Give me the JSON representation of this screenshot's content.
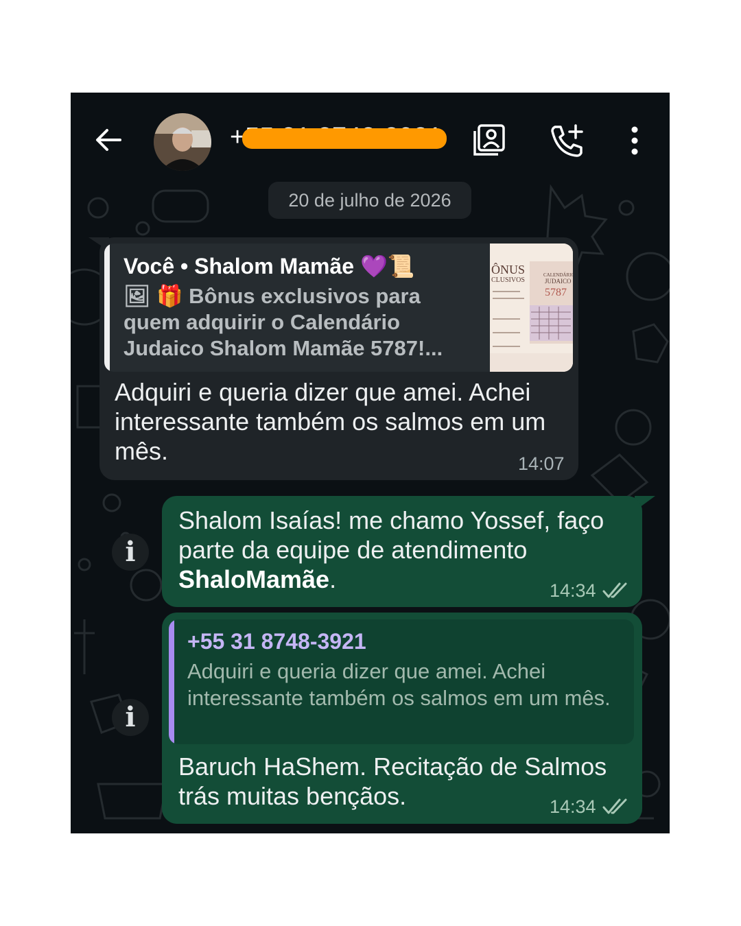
{
  "header": {
    "contact_title": "+55 31 8748-3921",
    "back_icon": "arrow-left-icon",
    "contacts_icon": "contact-card-icon",
    "call_icon": "add-call-icon",
    "menu_icon": "more-vert-icon"
  },
  "date_separator": "20 de julho de 2026",
  "incoming": {
    "quote_author": "Você • Shalom Mamãe 💜📜",
    "quote_text": "🖼 🎁 Bônus exclusivos para quem adquirir o Calendário Judaico Shalom Mamãe 5787!...",
    "text": "Adquiri e queria dizer que amei. Achei interessante também os salmos em um mês.",
    "time": "14:07"
  },
  "outgoing_1": {
    "text_prefix": "Shalom Isaías! me chamo Yossef, faço parte da equipe de atendimento ",
    "text_bold": "ShaloMamãe",
    "text_suffix": ".",
    "time": "14:34"
  },
  "outgoing_2": {
    "quote_author": "+55 31 8748-3921",
    "quote_text": "Adquiri e queria dizer que amei. Achei interessante também os salmos em um mês.",
    "text": "Baruch HaShem. Recitação de Salmos trás muitas bençãos.",
    "time": "14:34"
  },
  "info_label": "i",
  "colors": {
    "chat_background": "#0b1014",
    "incoming_bubble": "#1f2428",
    "outgoing_bubble": "#134d37",
    "read_ticks": "#a9c9b7",
    "quote_accent_purple": "#a78bf0",
    "redaction": "#ff9900"
  }
}
